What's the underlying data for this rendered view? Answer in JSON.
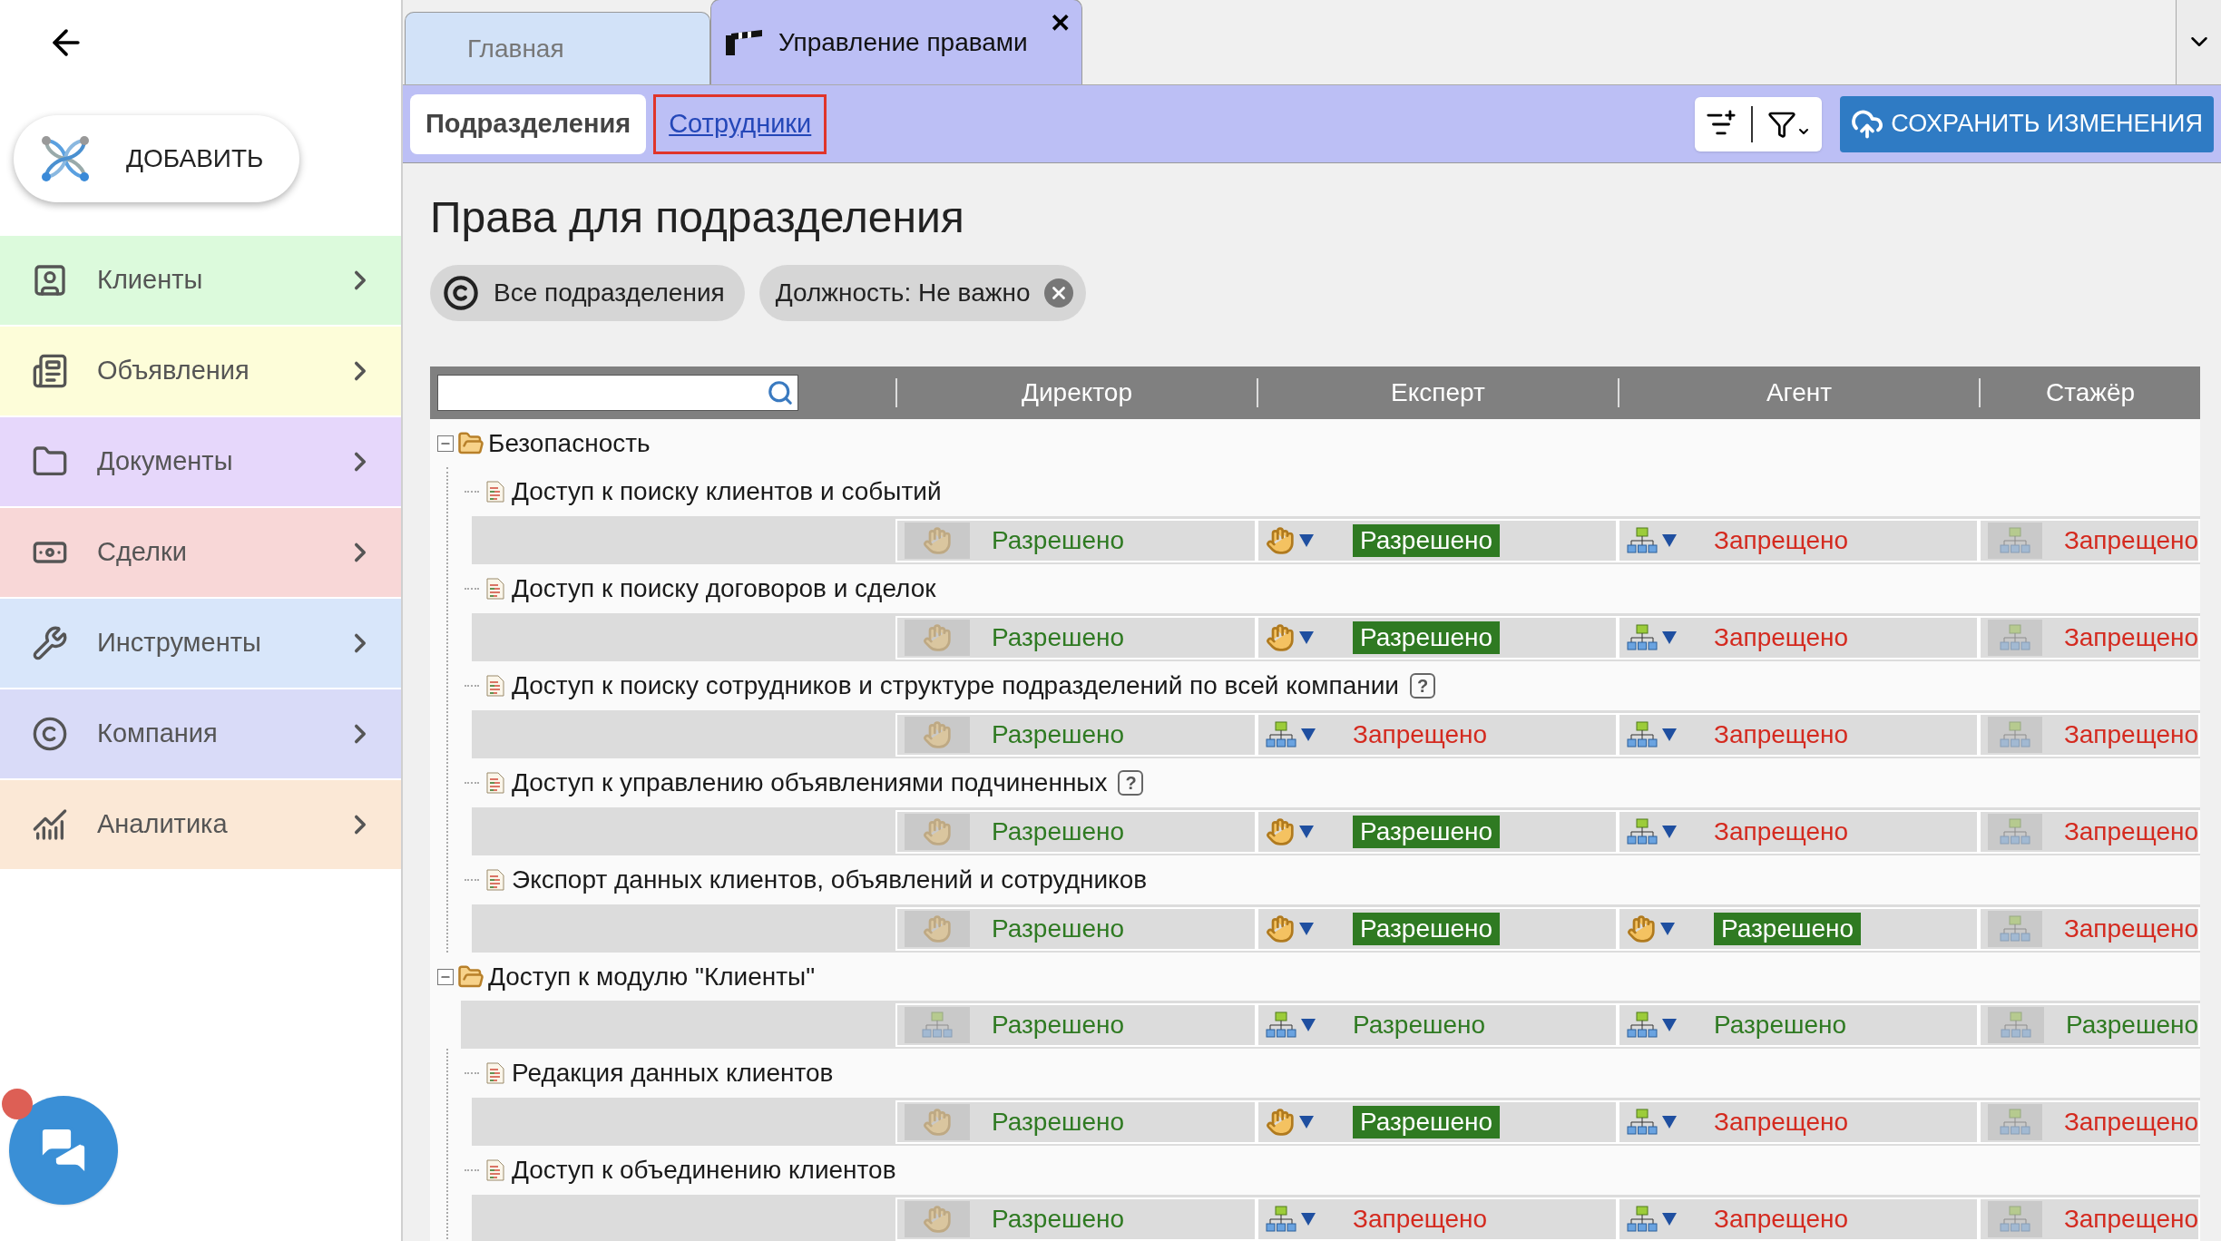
{
  "sidebar": {
    "add_button": "ДОБАВИТЬ",
    "items": [
      {
        "label": "Клиенты",
        "kind": "clients",
        "color": "#dcfadc"
      },
      {
        "label": "Объявления",
        "kind": "ads",
        "color": "#fdfdd9"
      },
      {
        "label": "Документы",
        "kind": "documents",
        "color": "#e6d7fb"
      },
      {
        "label": "Сделки",
        "kind": "deals",
        "color": "#f8d7d7"
      },
      {
        "label": "Инструменты",
        "kind": "tools",
        "color": "#d8e6fa"
      },
      {
        "label": "Компания",
        "kind": "company",
        "color": "#d9dbf8"
      },
      {
        "label": "Аналитика",
        "kind": "analytics",
        "color": "#fbe8d6"
      }
    ]
  },
  "tabs": [
    {
      "label": "Главная",
      "selected": false
    },
    {
      "label": "Управление правами",
      "selected": true,
      "close": "✕"
    }
  ],
  "subtabs": [
    {
      "label": "Подразделения",
      "selected": true,
      "outlined": false
    },
    {
      "label": "Сотрудники",
      "selected": false,
      "outlined": true
    }
  ],
  "save_button": "СОХРАНИТЬ ИЗМЕНЕНИЯ",
  "title": "Права для подразделения",
  "chips": [
    {
      "label": "Все подразделения",
      "kind": "company"
    },
    {
      "label": "Должность: Не важно",
      "kind": "removable"
    }
  ],
  "table": {
    "columns": [
      "Директор",
      "Експерт",
      "Агент",
      "Стажёр"
    ],
    "tree": [
      {
        "label": "Безопасность",
        "kind": "group",
        "expanded": true,
        "children": [
          {
            "label": "Доступ к поиску клиентов и событий",
            "kind": "item",
            "cells": [
              {
                "kind": "hand",
                "editable": false,
                "value": "Разрешено",
                "allowed": true,
                "highlighted": false
              },
              {
                "kind": "hand",
                "editable": true,
                "value": "Разрешено",
                "allowed": true,
                "highlighted": true
              },
              {
                "kind": "org",
                "editable": true,
                "value": "Запрещено",
                "allowed": false,
                "highlighted": false
              },
              {
                "kind": "org",
                "editable": false,
                "value": "Запрещено",
                "allowed": false,
                "highlighted": false
              }
            ]
          },
          {
            "label": "Доступ к поиску договоров и сделок",
            "kind": "item",
            "cells": [
              {
                "kind": "hand",
                "editable": false,
                "value": "Разрешено",
                "allowed": true,
                "highlighted": false
              },
              {
                "kind": "hand",
                "editable": true,
                "value": "Разрешено",
                "allowed": true,
                "highlighted": true
              },
              {
                "kind": "org",
                "editable": true,
                "value": "Запрещено",
                "allowed": false,
                "highlighted": false
              },
              {
                "kind": "org",
                "editable": false,
                "value": "Запрещено",
                "allowed": false,
                "highlighted": false
              }
            ]
          },
          {
            "label": "Доступ к поиску сотрудников и структуре подразделений по всей компании",
            "kind": "item",
            "help": "?",
            "cells": [
              {
                "kind": "hand",
                "editable": false,
                "value": "Разрешено",
                "allowed": true,
                "highlighted": false
              },
              {
                "kind": "org",
                "editable": true,
                "value": "Запрещено",
                "allowed": false,
                "highlighted": false
              },
              {
                "kind": "org",
                "editable": true,
                "value": "Запрещено",
                "allowed": false,
                "highlighted": false
              },
              {
                "kind": "org",
                "editable": false,
                "value": "Запрещено",
                "allowed": false,
                "highlighted": false
              }
            ]
          },
          {
            "label": "Доступ к управлению объявлениями подчиненных",
            "kind": "item",
            "help": "?",
            "cells": [
              {
                "kind": "hand",
                "editable": false,
                "value": "Разрешено",
                "allowed": true,
                "highlighted": false
              },
              {
                "kind": "hand",
                "editable": true,
                "value": "Разрешено",
                "allowed": true,
                "highlighted": true
              },
              {
                "kind": "org",
                "editable": true,
                "value": "Запрещено",
                "allowed": false,
                "highlighted": false
              },
              {
                "kind": "org",
                "editable": false,
                "value": "Запрещено",
                "allowed": false,
                "highlighted": false
              }
            ]
          },
          {
            "label": "Экспорт данных клиентов, объявлений и сотрудников",
            "kind": "item",
            "cells": [
              {
                "kind": "hand",
                "editable": false,
                "value": "Разрешено",
                "allowed": true,
                "highlighted": false
              },
              {
                "kind": "hand",
                "editable": true,
                "value": "Разрешено",
                "allowed": true,
                "highlighted": true
              },
              {
                "kind": "hand",
                "editable": true,
                "value": "Разрешено",
                "allowed": true,
                "highlighted": true
              },
              {
                "kind": "org",
                "editable": false,
                "value": "Запрещено",
                "allowed": false,
                "highlighted": false
              }
            ]
          }
        ]
      },
      {
        "label": "Доступ к модулю \"Клиенты\"",
        "kind": "group",
        "expanded": true,
        "cells": [
          {
            "kind": "org",
            "editable": false,
            "value": "Разрешено",
            "allowed": true,
            "highlighted": false
          },
          {
            "kind": "org",
            "editable": true,
            "value": "Разрешено",
            "allowed": true,
            "highlighted": false
          },
          {
            "kind": "org",
            "editable": true,
            "value": "Разрешено",
            "allowed": true,
            "highlighted": false
          },
          {
            "kind": "org",
            "editable": false,
            "value": "Разрешено",
            "allowed": true,
            "highlighted": false
          }
        ],
        "children": [
          {
            "label": "Редакция данных клиентов",
            "kind": "item",
            "cells": [
              {
                "kind": "hand",
                "editable": false,
                "value": "Разрешено",
                "allowed": true,
                "highlighted": false
              },
              {
                "kind": "hand",
                "editable": true,
                "value": "Разрешено",
                "allowed": true,
                "highlighted": true
              },
              {
                "kind": "org",
                "editable": true,
                "value": "Запрещено",
                "allowed": false,
                "highlighted": false
              },
              {
                "kind": "org",
                "editable": false,
                "value": "Запрещено",
                "allowed": false,
                "highlighted": false
              }
            ]
          },
          {
            "label": "Доступ к объединению клиентов",
            "kind": "item",
            "cells": [
              {
                "kind": "hand",
                "editable": false,
                "value": "Разрешено",
                "allowed": true,
                "highlighted": false
              },
              {
                "kind": "org",
                "editable": true,
                "value": "Запрещено",
                "allowed": false,
                "highlighted": false
              },
              {
                "kind": "org",
                "editable": true,
                "value": "Запрещено",
                "allowed": false,
                "highlighted": false
              },
              {
                "kind": "org",
                "editable": false,
                "value": "Запрещено",
                "allowed": false,
                "highlighted": false
              }
            ]
          }
        ]
      }
    ]
  }
}
